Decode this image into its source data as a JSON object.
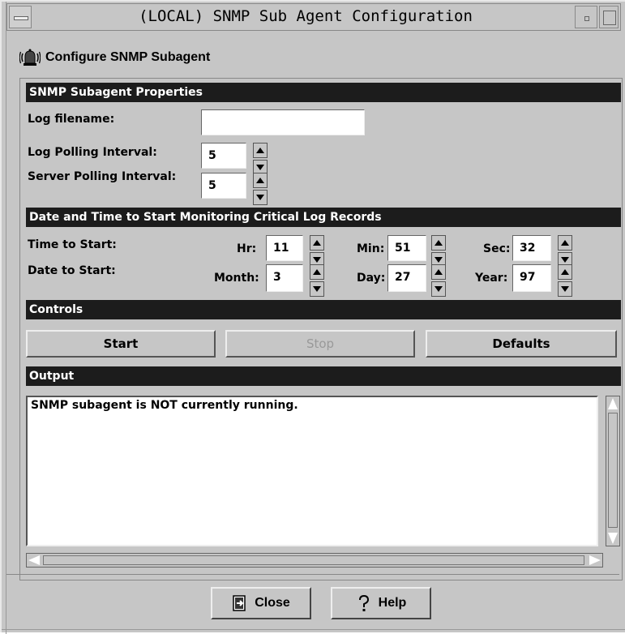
{
  "window": {
    "title": "(LOCAL) SNMP Sub Agent Configuration",
    "subtitle": "Configure SNMP Subagent"
  },
  "properties": {
    "header": "SNMP Subagent Properties",
    "log_filename_label": "Log filename:",
    "log_filename_value": "",
    "log_polling_label": "Log Polling Interval:",
    "log_polling_value": "5",
    "server_polling_label": "Server Polling Interval:",
    "server_polling_value": "5"
  },
  "schedule": {
    "header": "Date and Time to Start Monitoring Critical Log Records",
    "time_label": "Time to Start:",
    "date_label": "Date to Start:",
    "hr_label": "Hr:",
    "hr_value": "11",
    "min_label": "Min:",
    "min_value": "51",
    "sec_label": "Sec:",
    "sec_value": "32",
    "month_label": "Month:",
    "month_value": "3",
    "day_label": "Day:",
    "day_value": "27",
    "year_label": "Year:",
    "year_value": "97"
  },
  "controls": {
    "header": "Controls",
    "start_label": "Start",
    "stop_label": "Stop",
    "defaults_label": "Defaults"
  },
  "output": {
    "header": "Output",
    "text": "SNMP subagent is NOT currently running."
  },
  "dialog": {
    "close_label": "Close",
    "help_label": "Help"
  },
  "colors": {
    "background": "#c6c6c6",
    "section_header": "#1c1c1c",
    "field": "#ffffff"
  }
}
